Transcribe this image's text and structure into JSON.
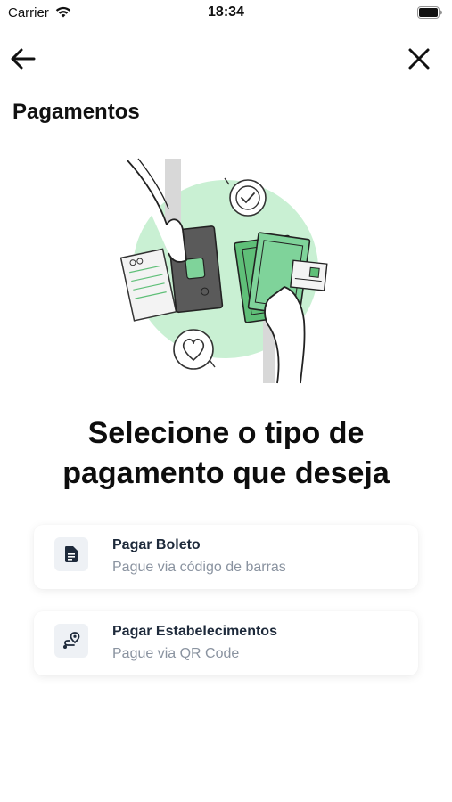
{
  "status_bar": {
    "carrier": "Carrier",
    "time": "18:34"
  },
  "nav": {
    "back_icon": "arrow-left-icon",
    "close_icon": "close-icon"
  },
  "page": {
    "title": "Pagamentos",
    "headline_line1": "Selecione o tipo de",
    "headline_line2": "pagamento que deseja"
  },
  "illustration": {
    "accent_color": "#c9f0d3",
    "money_color": "#5fbf78"
  },
  "options": [
    {
      "title": "Pagar Boleto",
      "subtitle": "Pague via código de barras",
      "icon": "document-icon"
    },
    {
      "title": "Pagar Estabelecimentos",
      "subtitle": "Pague via QR Code",
      "icon": "location-route-icon"
    }
  ]
}
